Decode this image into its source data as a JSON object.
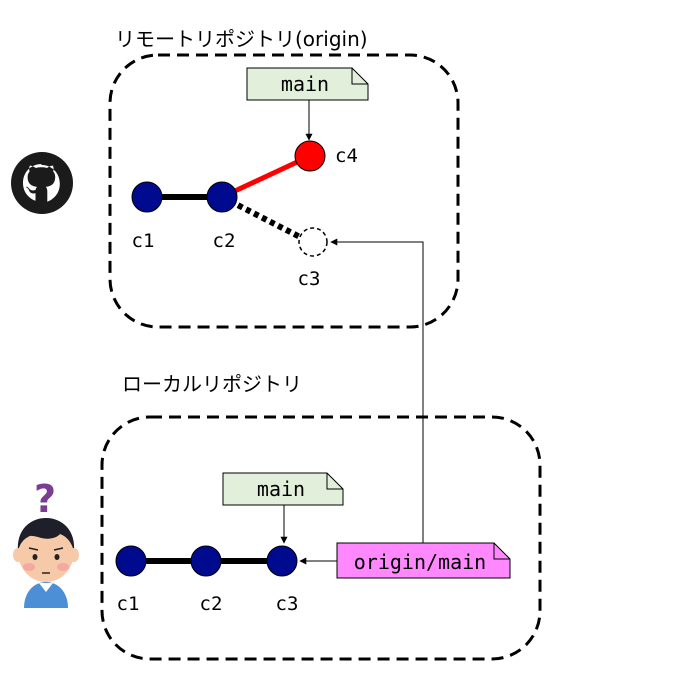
{
  "remote": {
    "title": "リモートリポジトリ(origin)",
    "branch_label": "main",
    "commits": [
      "c1",
      "c2",
      "c3",
      "c4"
    ]
  },
  "local": {
    "title": "ローカルリポジトリ",
    "branch_label": "main",
    "tracking_label": "origin/main",
    "commits": [
      "c1",
      "c2",
      "c3"
    ]
  },
  "colors": {
    "commit": "#000a8f",
    "new_commit": "#ff0000",
    "main_tag": "#e2efda",
    "tracking_tag": "#ff88ff"
  },
  "icons": [
    "github-logo-icon",
    "confused-user-icon",
    "question-mark-icon"
  ]
}
